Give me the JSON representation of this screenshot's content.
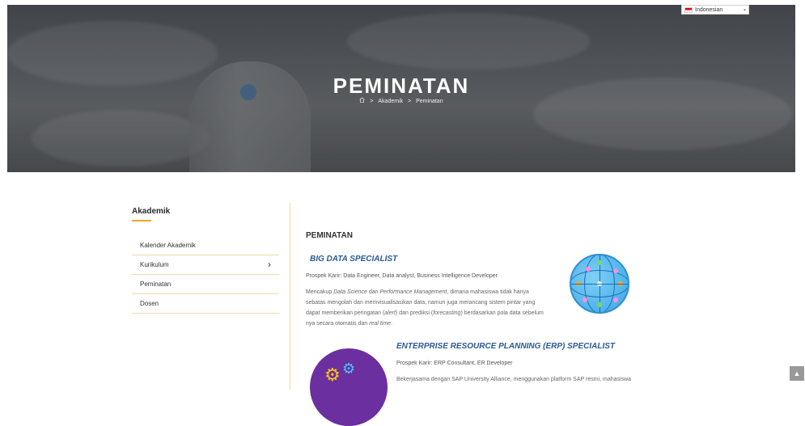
{
  "hero": {
    "title": "PEMINATAN",
    "breadcrumb": {
      "home_icon": "home-icon",
      "sep": ">",
      "item1": "Akademik",
      "item2": "Peminatan"
    }
  },
  "language": {
    "selected": "Indonesian",
    "flag_icon": "indonesia-flag-icon"
  },
  "sidebar": {
    "heading": "Akademik",
    "items": [
      {
        "label": "Kalender Akademik"
      },
      {
        "label": "Kurikulum",
        "has_submenu": true
      },
      {
        "label": "Peminatan"
      },
      {
        "label": "Dosen"
      }
    ]
  },
  "content": {
    "title": "PEMINATAN",
    "specializations": [
      {
        "title": "BIG DATA SPECIALIST",
        "career": "Prospek Karir: Data Engineer, Data analyst, Business Intelligence Developer",
        "desc": {
          "p1": "Mencakup ",
          "i1": "Data Science",
          "p2": " dan ",
          "i2": "Performance Management",
          "p3": ", dimana mahasiswa tidak hanya sebatas mengolah dan memvisualisasikan data, namun juga merancang sistem pintar yang dapat memberikan peringatan (",
          "i3": "alert",
          "p4": ") dan prediksi (",
          "i4": "forecasting",
          "p5": ") berdasarkan pola data sebelum nya secara otomatis dan ",
          "i5": "real time",
          "p6": "."
        },
        "image": "globe-network-icon"
      },
      {
        "title": "ENTERPRISE RESOURCE PLANNING (ERP) SPECIALIST",
        "career": "Prospek Karir: ERP Consultant, ER Developer",
        "desc_partial": "Bekerjasama dengan SAP University Alliance, menggunakan platform SAP resmi, mahasiswa",
        "image": "gears-icon"
      }
    ]
  },
  "scroll_top_icon": "chevron-up-icon",
  "colors": {
    "accent": "#f5a623",
    "title_blue": "#2a5a97",
    "hero_bg": "#55585c"
  }
}
